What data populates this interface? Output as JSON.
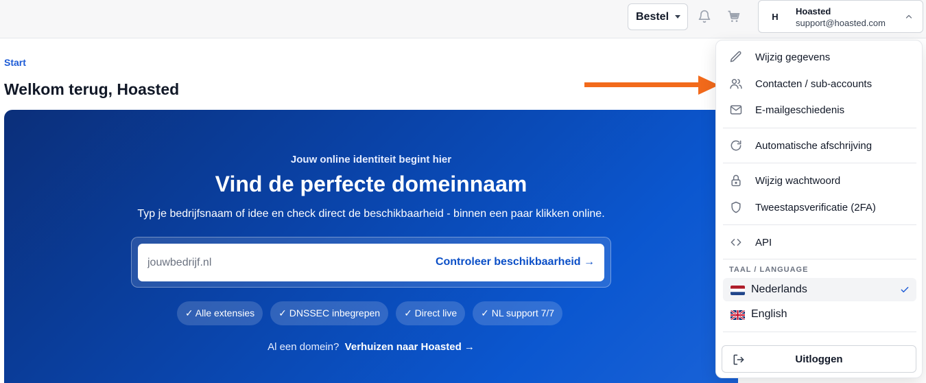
{
  "header": {
    "order_button_label": "Bestel",
    "account": {
      "avatar_initial": "H",
      "name": "Hoasted",
      "email": "support@hoasted.com"
    }
  },
  "page": {
    "breadcrumb": "Start",
    "title": "Welkom terug, Hoasted"
  },
  "hero": {
    "kicker": "Jouw online identiteit begint hier",
    "headline": "Vind de perfecte domeinnaam",
    "subtext": "Typ je bedrijfsnaam of idee en check direct de beschikbaarheid - binnen een paar klikken online.",
    "search_placeholder": "jouwbedrijf.nl",
    "search_cta": "Controleer beschikbaarheid →",
    "chips": [
      "✓ Alle extensies",
      "✓ DNSSEC inbegrepen",
      "✓ Direct live",
      "✓ NL support 7/7"
    ],
    "transfer_prefix": "Al een domein?",
    "transfer_link": "Verhuizen naar Hoasted →"
  },
  "account_menu": {
    "items": [
      {
        "label": "Wijzig gegevens",
        "icon": "pencil-icon"
      },
      {
        "label": "Contacten / sub-accounts",
        "icon": "users-icon"
      },
      {
        "label": "E-mailgeschiedenis",
        "icon": "mail-icon"
      },
      {
        "label": "Automatische afschrijving",
        "icon": "refresh-icon"
      },
      {
        "label": "Wijzig wachtwoord",
        "icon": "lock-icon"
      },
      {
        "label": "Tweestapsverificatie (2FA)",
        "icon": "shield-icon"
      },
      {
        "label": "API",
        "icon": "code-icon"
      }
    ],
    "language_section": "TAAL / LANGUAGE",
    "languages": [
      {
        "label": "Nederlands",
        "selected": true
      },
      {
        "label": "English",
        "selected": false
      }
    ],
    "logout_label": "Uitloggen"
  },
  "colors": {
    "accent_blue": "#0b4fc7",
    "annotation_arrow": "#f26a1b"
  }
}
